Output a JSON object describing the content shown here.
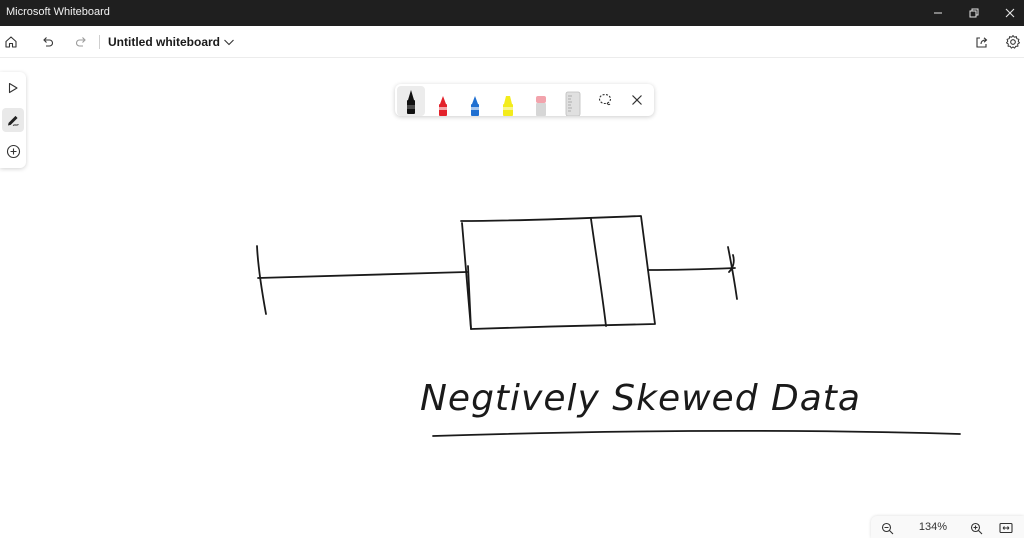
{
  "window": {
    "title": "Microsoft Whiteboard",
    "controls": [
      "minimize-icon",
      "restore-icon",
      "close-icon"
    ]
  },
  "appbar": {
    "document_title": "Untitled whiteboard",
    "icons": [
      "home-icon",
      "undo-icon",
      "redo-icon",
      "chevron-down-icon",
      "share-icon",
      "settings-icon"
    ]
  },
  "sidebar": {
    "tools": [
      {
        "name": "select",
        "icon": "pointer-icon",
        "active": false
      },
      {
        "name": "ink",
        "icon": "pen-icon",
        "active": true
      },
      {
        "name": "add",
        "icon": "plus-circle-icon",
        "active": false
      }
    ]
  },
  "ink_toolbar": {
    "pens": [
      {
        "name": "black-pen",
        "color": "#111111",
        "active": true
      },
      {
        "name": "red-pen",
        "color": "#e3222b",
        "active": false
      },
      {
        "name": "blue-pen",
        "color": "#1f6fd1",
        "active": false
      },
      {
        "name": "yellow-highlighter",
        "color": "#f3ec1c",
        "active": false
      },
      {
        "name": "eraser",
        "color": "#f2a3ac",
        "active": false
      },
      {
        "name": "ruler",
        "color": "#d9d9d9",
        "active": false
      }
    ],
    "extra_icons": [
      "lasso-icon",
      "close-icon"
    ]
  },
  "canvas": {
    "handwritten_text": "Negtively Skewed Data",
    "drawing": "box-plot"
  },
  "zoom": {
    "level": "134%",
    "icons": [
      "zoom-out-icon",
      "zoom-in-icon",
      "fit-to-screen-icon"
    ]
  },
  "colors": {
    "titlebar": "#1f1f1f",
    "ink": "#1a1a1a",
    "canvas": "#ffffff"
  }
}
